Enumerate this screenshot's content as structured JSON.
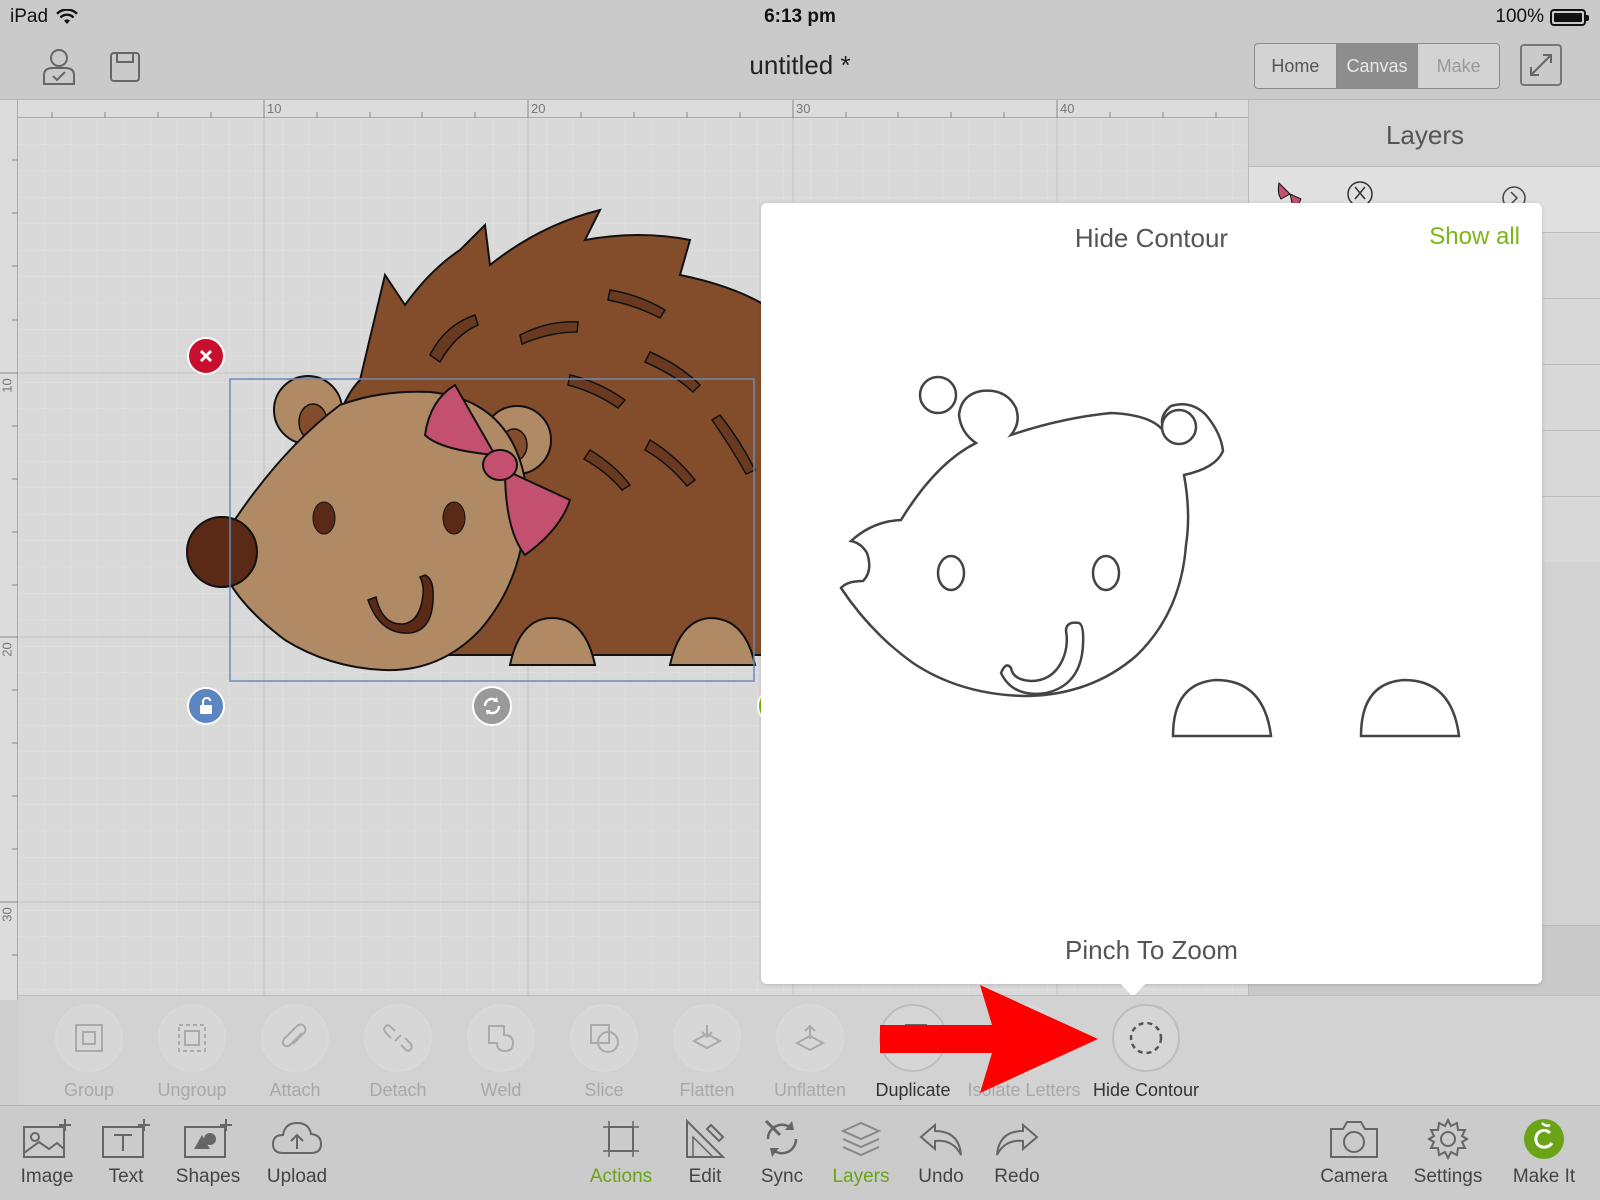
{
  "status_bar": {
    "device": "iPad",
    "time": "6:13 pm",
    "battery": "100%"
  },
  "header": {
    "title": "untitled *",
    "tabs": [
      {
        "label": "Home",
        "active": false
      },
      {
        "label": "Canvas",
        "active": true
      },
      {
        "label": "Make",
        "active": false
      }
    ]
  },
  "ruler": {
    "top_labels": [
      "10",
      "20",
      "30",
      "40"
    ],
    "left_labels": [
      "10",
      "20",
      "30"
    ]
  },
  "layers_panel": {
    "title": "Layers"
  },
  "popover": {
    "title": "Hide Contour",
    "show_all": "Show all",
    "footer": "Pinch To Zoom"
  },
  "actions": [
    {
      "label": "Group",
      "icon": "group-icon",
      "enabled": false
    },
    {
      "label": "Ungroup",
      "icon": "ungroup-icon",
      "enabled": false
    },
    {
      "label": "Attach",
      "icon": "paperclip-icon",
      "enabled": false
    },
    {
      "label": "Detach",
      "icon": "detach-icon",
      "enabled": false
    },
    {
      "label": "Weld",
      "icon": "weld-icon",
      "enabled": false
    },
    {
      "label": "Slice",
      "icon": "slice-icon",
      "enabled": false
    },
    {
      "label": "Flatten",
      "icon": "flatten-icon",
      "enabled": false
    },
    {
      "label": "Unflatten",
      "icon": "unflatten-icon",
      "enabled": false
    },
    {
      "label": "Duplicate",
      "icon": "duplicate-icon",
      "enabled": true
    },
    {
      "label": "Isolate Letters",
      "icon": "isolate-letters-icon",
      "enabled": false
    },
    {
      "label": "Hide Contour",
      "icon": "hide-contour-icon",
      "enabled": true
    }
  ],
  "bottom_tools": [
    {
      "label": "Image",
      "icon": "image-add-icon",
      "active": false
    },
    {
      "label": "Text",
      "icon": "text-add-icon",
      "active": false
    },
    {
      "label": "Shapes",
      "icon": "shapes-add-icon",
      "active": false
    },
    {
      "label": "Upload",
      "icon": "upload-cloud-icon",
      "active": false
    },
    {
      "label": "Actions",
      "icon": "actions-icon",
      "active": true
    },
    {
      "label": "Edit",
      "icon": "edit-ruler-icon",
      "active": false
    },
    {
      "label": "Sync",
      "icon": "sync-icon",
      "active": false
    },
    {
      "label": "Layers",
      "icon": "layers-icon",
      "active": true
    },
    {
      "label": "Undo",
      "icon": "undo-icon",
      "active": false
    },
    {
      "label": "Redo",
      "icon": "redo-icon",
      "active": false
    },
    {
      "label": "Camera",
      "icon": "camera-icon",
      "active": false
    },
    {
      "label": "Settings",
      "icon": "gear-icon",
      "active": false
    },
    {
      "label": "Make It",
      "icon": "make-it-icon",
      "active": false
    }
  ],
  "colors": {
    "accent_green": "#7cb518",
    "hedgehog_body": "#834d2b",
    "hedgehog_face": "#b08a64",
    "bow": "#c4506f",
    "delete_handle": "#c8102e",
    "lock_handle": "#5b86c2",
    "annotation_arrow": "#ff0000"
  }
}
